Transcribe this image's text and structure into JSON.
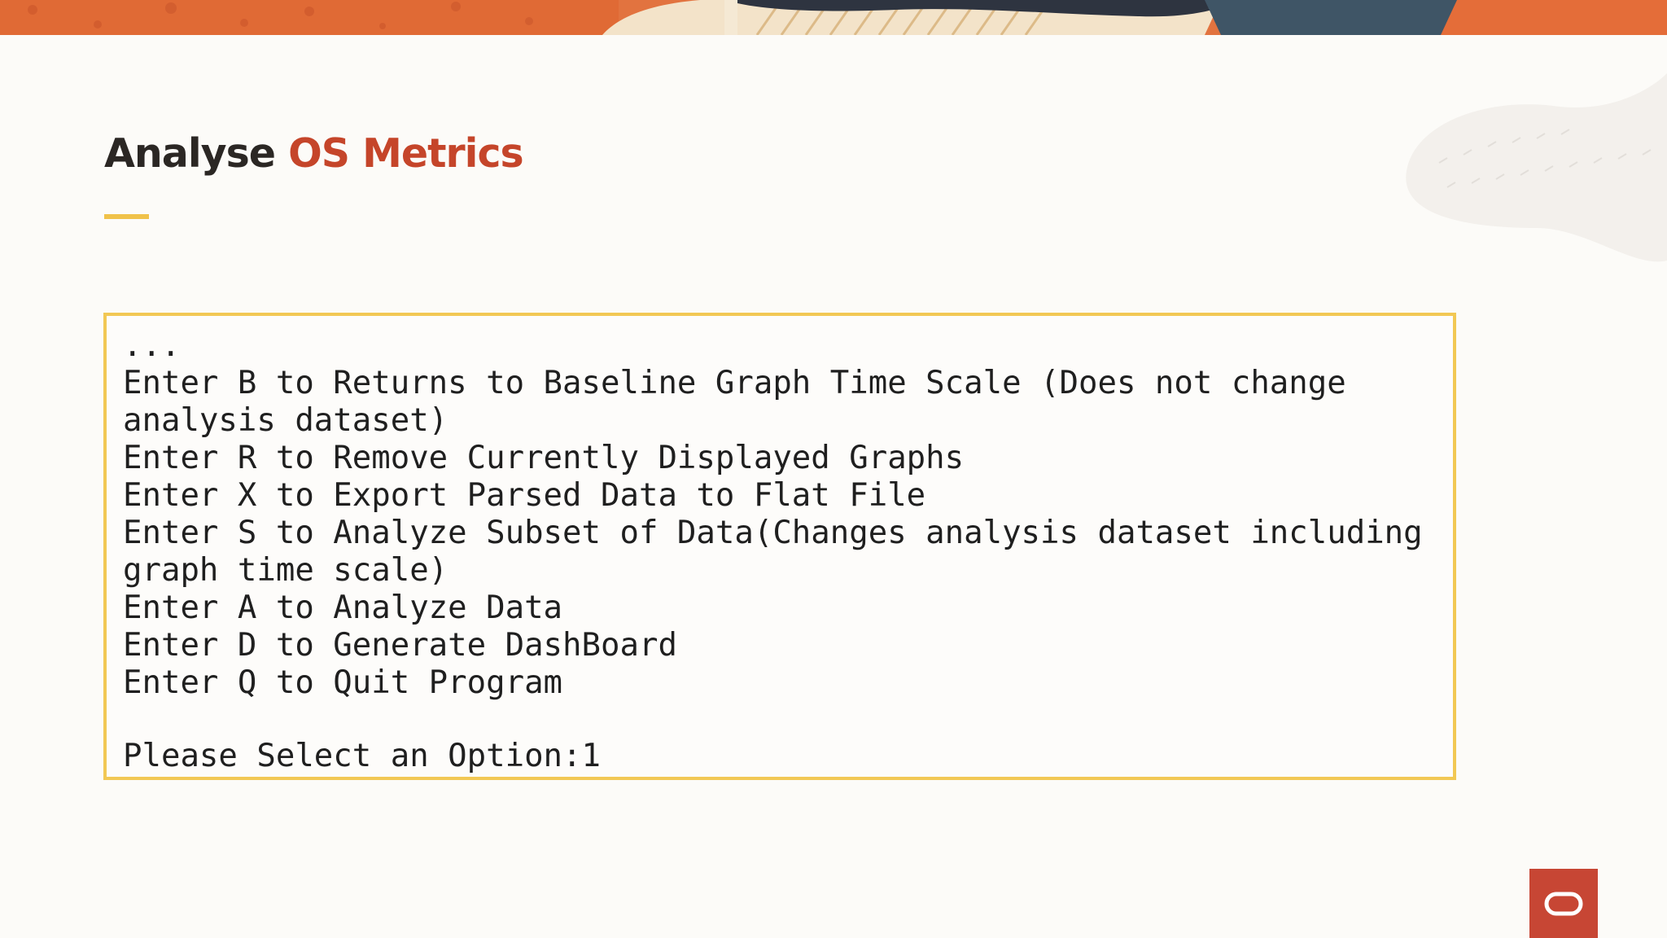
{
  "slide": {
    "title_prefix": "Analyse",
    "title_accent": "OS Metrics"
  },
  "terminal": {
    "lines": [
      "...",
      "Enter B to Returns to Baseline Graph Time Scale (Does not change",
      "analysis dataset)",
      "Enter R to Remove Currently Displayed Graphs",
      "Enter X to Export Parsed Data to Flat File",
      "Enter S to Analyze Subset of Data(Changes analysis dataset including",
      "graph time scale)",
      "Enter A to Analyze Data",
      "Enter D to Generate DashBoard",
      "Enter Q to Quit Program"
    ],
    "prompt": "Please Select an Option:1"
  },
  "colors": {
    "accent_red": "#c5452a",
    "title_dark": "#2b2724",
    "rule_yellow": "#f0c24a",
    "terminal_border": "#f2c854",
    "badge_red": "#c74634"
  },
  "icons": {
    "brand_logo": "oracle-logo-icon"
  }
}
